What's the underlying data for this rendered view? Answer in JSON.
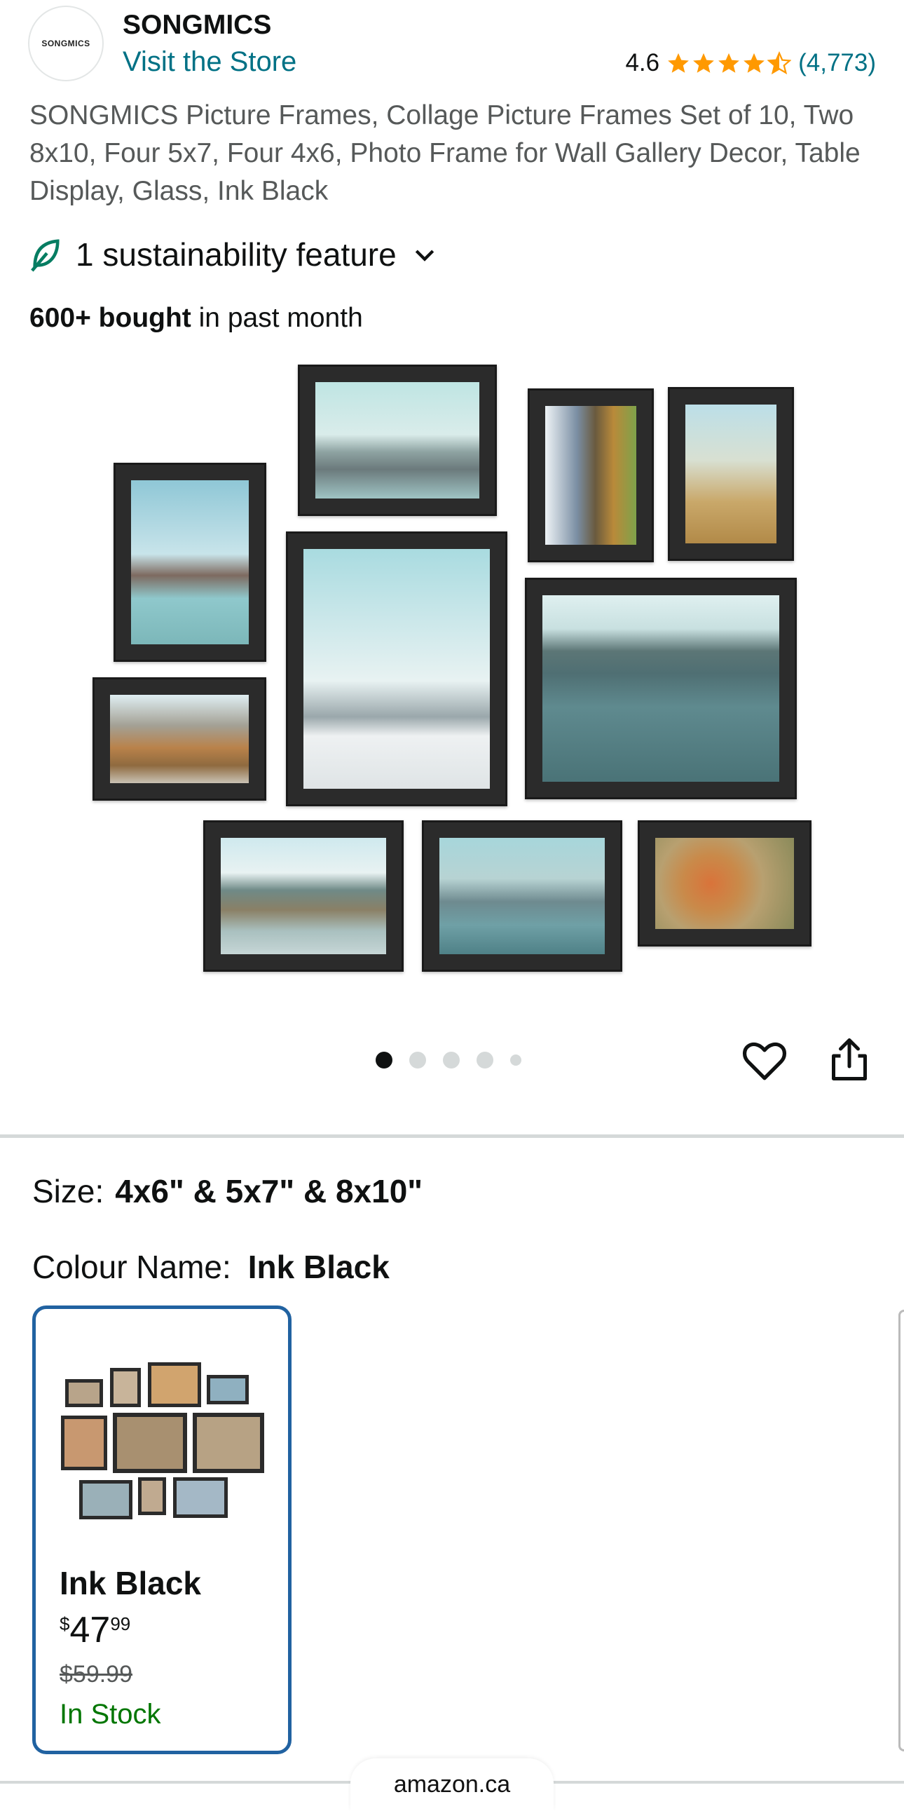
{
  "brand": {
    "logo_text": "SONGMICS",
    "name": "SONGMICS",
    "visit_store": "Visit the Store"
  },
  "rating": {
    "value": "4.6",
    "stars": 4.5,
    "count": "(4,773)"
  },
  "product": {
    "title": "SONGMICS Picture Frames, Collage Picture Frames Set of 10, Two 8x10, Four 5x7, Four 4x6, Photo Frame for Wall Gallery Decor, Table Display, Glass, Ink Black",
    "sustainability": "1 sustainability feature",
    "bought_bold": "600+ bought",
    "bought_rest": " in past month"
  },
  "gallery": {
    "image_count": 5,
    "active_index": 0
  },
  "options": {
    "size_label": "Size:",
    "size_value": "4x6\" & 5x7\" & 8x10\"",
    "colour_label": "Colour Name:",
    "colour_value": "Ink Black"
  },
  "swatch": {
    "name": "Ink Black",
    "currency": "$",
    "price_whole": "47",
    "price_fraction": "99",
    "was_price": "$59.99",
    "stock": "In Stock"
  },
  "footer": {
    "url": "amazon.ca"
  },
  "colors": {
    "link": "#007185",
    "star": "#ff9900",
    "in_stock": "#007600",
    "selected_border": "#2162a1",
    "leaf": "#067d62"
  }
}
